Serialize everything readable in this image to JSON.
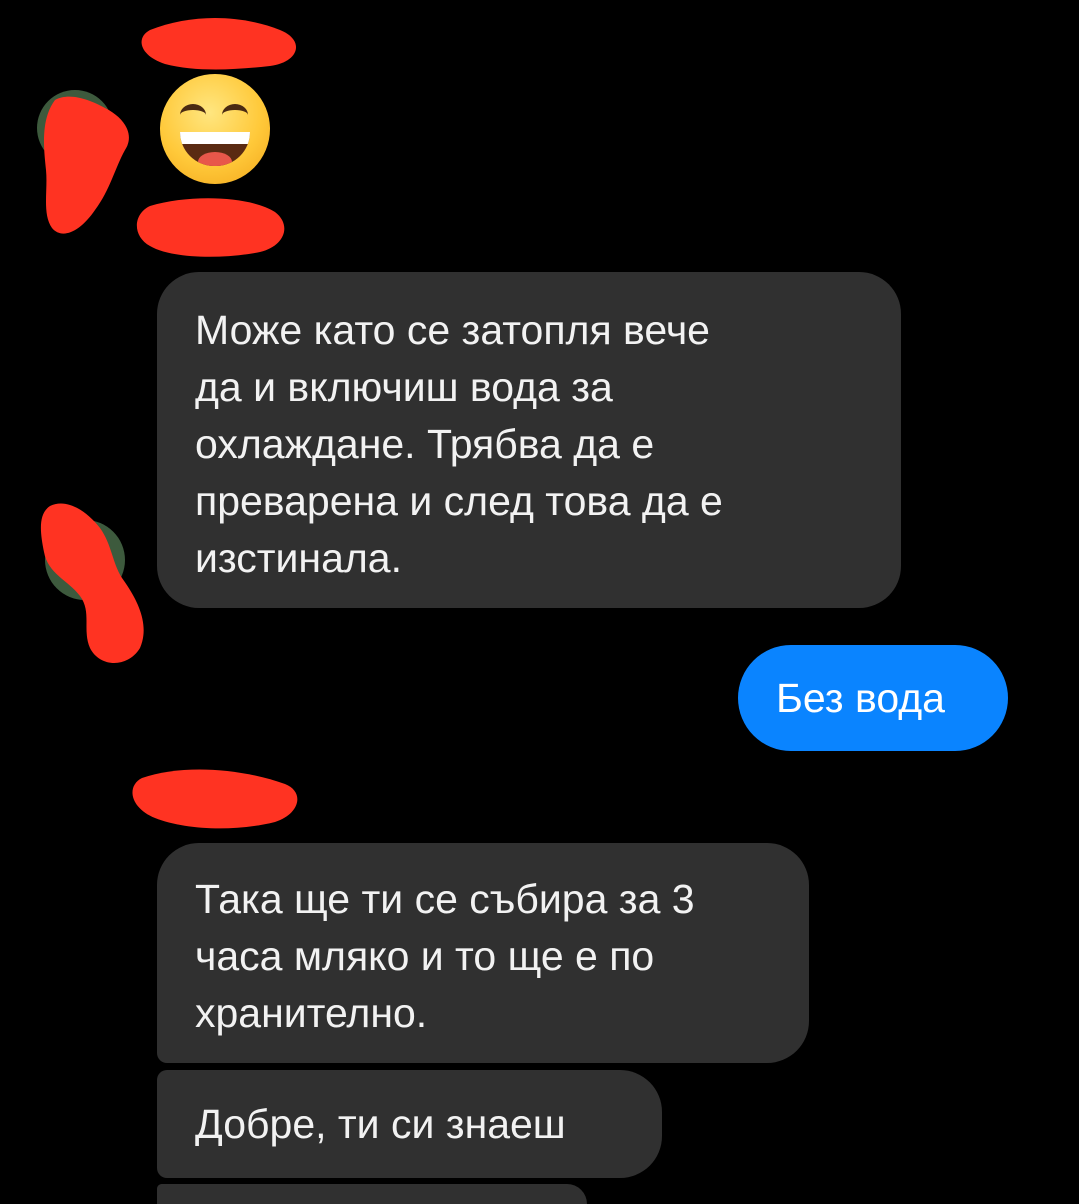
{
  "conversation": {
    "messages": [
      {
        "direction": "incoming",
        "lines": [
          "Може като се затопля вече",
          "да и включиш вода за",
          "охлаждане. Трябва да е",
          "преварена и след това да е",
          "изстинала."
        ]
      },
      {
        "direction": "outgoing",
        "lines": [
          "Без вода"
        ]
      },
      {
        "direction": "incoming",
        "lines": [
          "Така ще ти се събира за 3",
          "часа мляко и то ще е по",
          "хранително."
        ]
      },
      {
        "direction": "incoming",
        "lines": [
          "Добре, ти си знаеш"
        ]
      }
    ],
    "emoji_message": "grinning-squinting-face-emoji"
  },
  "colors": {
    "background": "#000000",
    "incoming_bubble": "#303030",
    "outgoing_bubble": "#0a84ff",
    "redaction": "#ff3322"
  }
}
